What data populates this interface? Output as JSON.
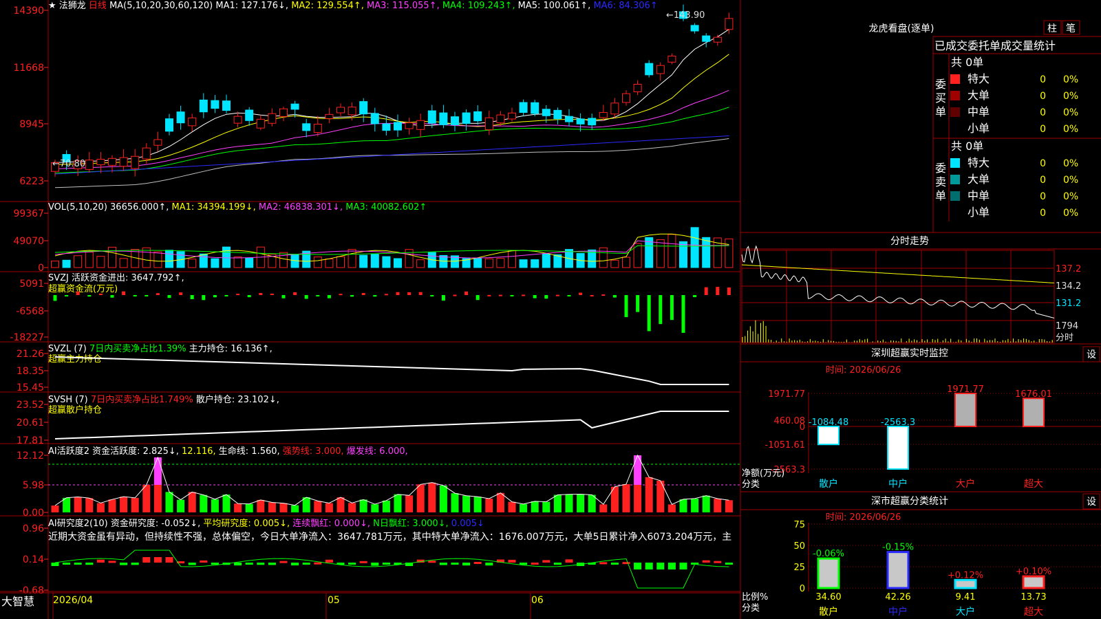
{
  "app": {
    "brand": "大智慧",
    "stock_name": "法狮龙",
    "period": "日线"
  },
  "colors": {
    "up": "#ff2020",
    "down": "#00e5ff",
    "grid": "#a00000",
    "ma1": "#ffffff",
    "ma2": "#ffff00",
    "ma3": "#ff40ff",
    "ma4": "#00ff00",
    "ma5": "#c0c0c0",
    "ma6": "#2a2aff"
  },
  "price_panel": {
    "y_ticks": [
      "14390",
      "11668",
      "8945",
      "6223"
    ],
    "header": [
      {
        "t": "MA(5,10,20,30,60,120)",
        "c": "#ffffff"
      },
      {
        "t": "MA1: 127.176↓,",
        "c": "#ffffff"
      },
      {
        "t": "MA2: 129.554↑,",
        "c": "#ffff00"
      },
      {
        "t": "MA3: 115.055↑,",
        "c": "#ff40ff"
      },
      {
        "t": "MA4: 109.243↑,",
        "c": "#00ff00"
      },
      {
        "t": "MA5: 100.061↑,",
        "c": "#ffffff"
      },
      {
        "t": "MA6: 84.306↑",
        "c": "#2a2aff"
      }
    ],
    "high_label": "143.90",
    "low_label": "70.80"
  },
  "vol_panel": {
    "y_ticks": [
      "99367",
      "49070",
      "0"
    ],
    "header": [
      {
        "t": "VOL(5,10,20)",
        "c": "#ffffff"
      },
      {
        "t": "36656.000↑,",
        "c": "#ffffff"
      },
      {
        "t": "MA1: 34394.199↓,",
        "c": "#ffff00"
      },
      {
        "t": "MA2: 46838.301↓,",
        "c": "#ff40ff"
      },
      {
        "t": "MA3: 40082.602↑",
        "c": "#00ff00"
      }
    ]
  },
  "svzj_panel": {
    "y_ticks": [
      "5091",
      "-6568",
      "-18227"
    ],
    "header": [
      {
        "t": "SVZJ",
        "c": "#ffffff"
      },
      {
        "t": "活跃资金进出: 3647.792↑,",
        "c": "#ffffff"
      }
    ],
    "subtitle": "超赢资金流(万元)"
  },
  "svzl_panel": {
    "y_ticks": [
      "21.26",
      "18.35",
      "15.45"
    ],
    "header": [
      {
        "t": "SVZL (7)",
        "c": "#ffffff"
      },
      {
        "t": "7日内买卖净占比1.39%",
        "c": "#00ff00"
      },
      {
        "t": "主力持仓: 16.136↑,",
        "c": "#ffffff"
      }
    ],
    "subtitle": "超赢主力持仓"
  },
  "svsh_panel": {
    "y_ticks": [
      "23.52",
      "20.61",
      "17.81"
    ],
    "header": [
      {
        "t": "SVSH (7)",
        "c": "#ffffff"
      },
      {
        "t": "7日内买卖净占比1.749%",
        "c": "#ff2020"
      },
      {
        "t": "散户持仓: 23.102↓,",
        "c": "#ffffff"
      }
    ],
    "subtitle": "超赢散户持仓"
  },
  "ai_panel": {
    "y_ticks": [
      "12.12",
      "5.98",
      "0.00"
    ],
    "header": [
      {
        "t": "AI活跃度2",
        "c": "#ffffff"
      },
      {
        "t": "资金活跃度: 2.825↓,",
        "c": "#ffffff"
      },
      {
        "t": "12.116,",
        "c": "#ffff00"
      },
      {
        "t": "生命线: 1.560,",
        "c": "#ffffff"
      },
      {
        "t": "强势线: 3.000,",
        "c": "#ff2020"
      },
      {
        "t": "爆发线: 6.000,",
        "c": "#ff40ff"
      }
    ]
  },
  "research_panel": {
    "y_ticks": [
      "0.96",
      "0.14",
      "-0.68"
    ],
    "header": [
      {
        "t": "AI研究度2(10)",
        "c": "#ffffff"
      },
      {
        "t": "资金研究度: -0.052↓,",
        "c": "#ffffff"
      },
      {
        "t": "平均研究度: 0.005↓,",
        "c": "#ffff00"
      },
      {
        "t": "连续飘红: 0.000↓,",
        "c": "#ff40ff"
      },
      {
        "t": "N日飘红: 3.000↓,",
        "c": "#00ff00"
      },
      {
        "t": "0.005↓",
        "c": "#2a2aff"
      }
    ],
    "commentary": "近期大资金虽有异动，但持续性不强，总体偏空，今日大单净流入：3647.781万元，其中特大单净流入：1676.007万元，大单5日累计净入6073.204万元，主"
  },
  "x_axis": {
    "labels": [
      "2026/04",
      "05",
      "06"
    ]
  },
  "dragon": {
    "title": "龙虎看盘(逐单)",
    "btn_bar": "柱",
    "btn_pen": "笔",
    "header": "已成交委托单成交量统计",
    "buy": {
      "side_label": "委买单",
      "count": "共 0单",
      "rows": [
        {
          "name": "特大",
          "qty": "0",
          "pct": "0%",
          "color": "#ff2020"
        },
        {
          "name": "大单",
          "qty": "0",
          "pct": "0%",
          "color": "#a00000"
        },
        {
          "name": "中单",
          "qty": "0",
          "pct": "0%",
          "color": "#600000"
        },
        {
          "name": "小单",
          "qty": "0",
          "pct": "0%",
          "color": ""
        }
      ]
    },
    "sell": {
      "side_label": "委卖单",
      "count": "共 0单",
      "rows": [
        {
          "name": "特大",
          "qty": "0",
          "pct": "0%",
          "color": "#00e5ff"
        },
        {
          "name": "大单",
          "qty": "0",
          "pct": "0%",
          "color": "#009a9a"
        },
        {
          "name": "中单",
          "qty": "0",
          "pct": "0%",
          "color": "#006e6e"
        },
        {
          "name": "小单",
          "qty": "0",
          "pct": "0%",
          "color": ""
        }
      ]
    }
  },
  "intraday": {
    "title": "分时走势",
    "y_ticks": [
      "137.2",
      "134.2",
      "131.2"
    ],
    "vol_tick": "1794",
    "unit": "分时"
  },
  "realtime_monitor": {
    "title": "深圳超赢实时监控",
    "setting": "设",
    "time": "时间: 2026/06/26",
    "y_ticks": [
      "1971.77",
      "460.08",
      "0",
      "-1051.61",
      "-2563.3"
    ],
    "axis_label": "净额(万元)",
    "category_label": "分类",
    "chart_data": {
      "type": "bar",
      "categories": [
        "散户",
        "中户",
        "大户",
        "超大"
      ],
      "values": [
        -1084.48,
        -2563.3,
        1971.77,
        1676.01
      ],
      "value_labels": [
        "-1084.48",
        "-2563.3",
        "1971.77",
        "1676.01"
      ],
      "ylabel": "净额(万元)",
      "ylim": [
        -2563.3,
        1971.77
      ]
    }
  },
  "classification": {
    "title": "深市超赢分类统计",
    "setting": "设",
    "time": "时间: 2026/06/26",
    "y_ticks": [
      "75",
      "50",
      "25",
      "0"
    ],
    "axis_label": "比例%",
    "category_label": "分类",
    "chart_data": {
      "type": "bar",
      "categories": [
        "散户",
        "中户",
        "大户",
        "超大"
      ],
      "values": [
        34.6,
        42.26,
        9.41,
        13.73
      ],
      "value_labels": [
        "34.60",
        "42.26",
        "9.41",
        "13.73"
      ],
      "change_labels": [
        "-0.06%",
        "-0.15%",
        "+0.12%",
        "+0.10%"
      ],
      "ylabel": "比例%",
      "ylim": [
        0,
        75
      ]
    }
  }
}
